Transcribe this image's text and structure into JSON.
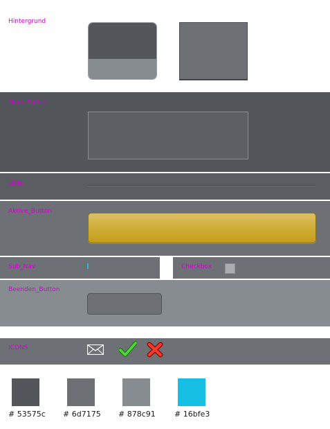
{
  "labels": {
    "hintergrund": "Hintergrund",
    "main_button": "Main_Button",
    "linie": "Linie",
    "active_button": "Aktive_Button",
    "sub_nav": "Sub_Nav",
    "checkbox": "Checkbox",
    "beenden_button": "Beenden_Button",
    "icons": "ICONS"
  },
  "icons": [
    "mail-icon",
    "check-icon",
    "close-icon"
  ],
  "colors": {
    "dark": "#53575c",
    "mid": "#6d7175",
    "light": "#878c91",
    "accent": "#16bfe3",
    "label": "#d400d4",
    "gold": "#c9a21e"
  },
  "swatches": [
    {
      "hex": "#53575c",
      "label": "# 53575c"
    },
    {
      "hex": "#6d7175",
      "label": "# 6d7175"
    },
    {
      "hex": "#878c91",
      "label": "# 878c91"
    },
    {
      "hex": "#16bfe3",
      "label": "# 16bfe3"
    }
  ]
}
